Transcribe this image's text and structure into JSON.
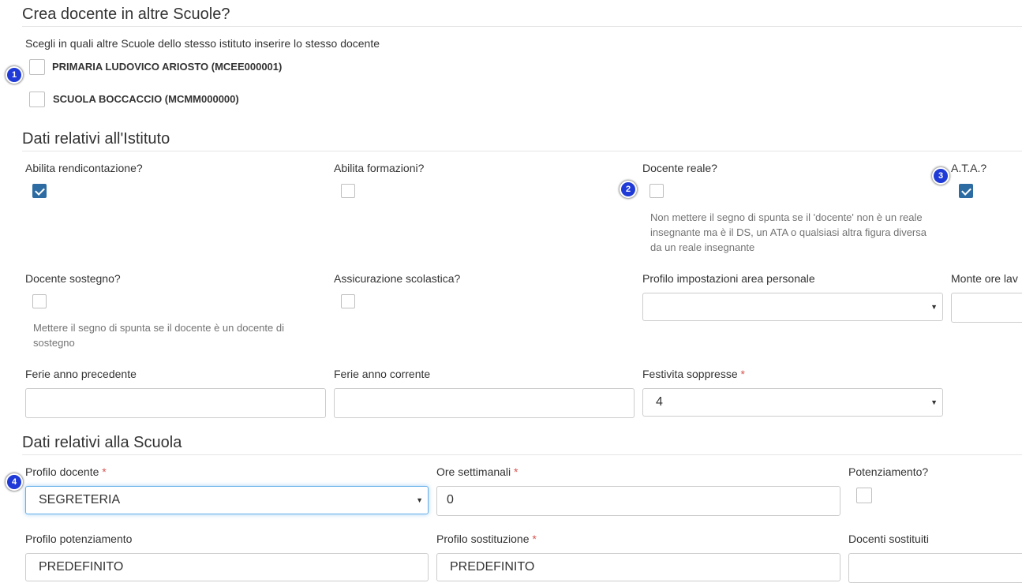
{
  "section_other_schools": {
    "title": "Crea docente in altre Scuole?",
    "subtitle": "Scegli in quali altre Scuole dello stesso istituto inserire lo stesso docente",
    "schools": [
      {
        "label": "PRIMARIA LUDOVICO ARIOSTO (MCEE000001)",
        "checked": false
      },
      {
        "label": "SCUOLA BOCCACCIO (MCMM000000)",
        "checked": false
      }
    ]
  },
  "section_institute": {
    "title": "Dati relativi all'Istituto",
    "abilita_rendicontazione": {
      "label": "Abilita rendicontazione?",
      "checked": true
    },
    "abilita_formazioni": {
      "label": "Abilita formazioni?",
      "checked": false
    },
    "docente_reale": {
      "label": "Docente reale?",
      "checked": false,
      "help_lines": [
        "Non mettere il segno di spunta se il 'docente' non è un reale",
        "insegnante ma è il DS, un ATA o qualsiasi altra figura diversa",
        "da un reale insegnante"
      ]
    },
    "ata": {
      "label": "A.T.A.?",
      "checked": true
    },
    "docente_sostegno": {
      "label": "Docente sostegno?",
      "checked": false,
      "help_lines": [
        "Mettere il segno di spunta se il docente è un docente di",
        "sostegno"
      ]
    },
    "assicurazione": {
      "label": "Assicurazione scolastica?",
      "checked": false
    },
    "profilo_impostazioni": {
      "label": "Profilo impostazioni area personale",
      "value": ""
    },
    "monte_ore": {
      "label": "Monte ore lav",
      "value": ""
    },
    "ferie_precedente": {
      "label": "Ferie anno precedente",
      "value": ""
    },
    "ferie_corrente": {
      "label": "Ferie anno corrente",
      "value": ""
    },
    "festivita_soppresse": {
      "label": "Festivita soppresse",
      "required_mark": "*",
      "value": "4"
    }
  },
  "section_school": {
    "title": "Dati relativi alla Scuola",
    "profilo_docente": {
      "label": "Profilo docente",
      "required_mark": "*",
      "value": "SEGRETERIA"
    },
    "ore_settimanali": {
      "label": "Ore settimanali",
      "required_mark": "*",
      "value": "0"
    },
    "potenziamento": {
      "label": "Potenziamento?",
      "checked": false
    },
    "profilo_potenziamento": {
      "label": "Profilo potenziamento",
      "value": "PREDEFINITO"
    },
    "profilo_sostituzione": {
      "label": "Profilo sostituzione",
      "required_mark": "*",
      "value": "PREDEFINITO"
    },
    "docenti_sostituiti": {
      "label": "Docenti sostituiti",
      "value": ""
    }
  },
  "annotations": [
    "1",
    "2",
    "3",
    "4"
  ],
  "icons": {
    "select_caret": "caret-down-icon",
    "check": "check-icon"
  },
  "colors": {
    "checkbox_checked": "#2d6ca2",
    "required": "#d9534f",
    "badge": "#1f3ad6",
    "focus": "#66afe9"
  }
}
